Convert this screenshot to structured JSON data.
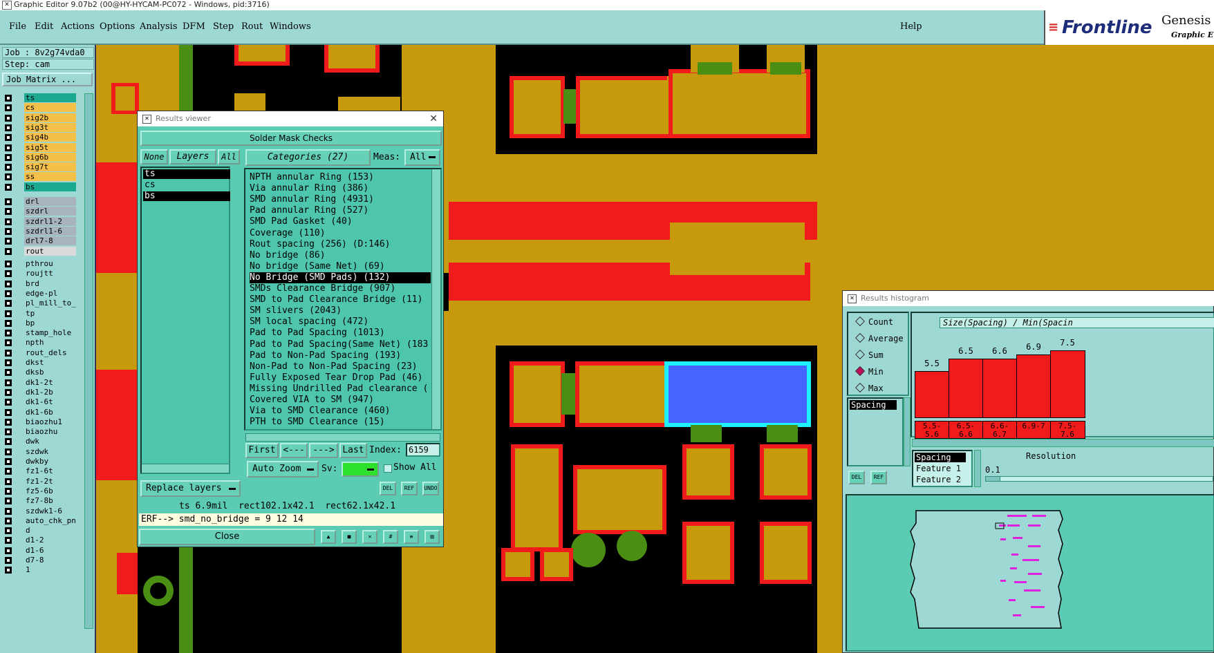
{
  "window": {
    "title": "Graphic Editor 9.07b2 (00@HY-HYCAM-PC072 - Windows, pid:3716)"
  },
  "menu": {
    "items": [
      "File",
      "Edit",
      "Actions",
      "Options",
      "Analysis",
      "DFM",
      "Step",
      "Rout",
      "Windows"
    ],
    "help": "Help"
  },
  "brand": {
    "logo": "Frontline",
    "product": "Genesis",
    "sub": "Graphic E"
  },
  "left": {
    "job": "Job : 8v2g74vda0",
    "step": "Step: cam",
    "job_matrix": "Job Matrix ...",
    "layers": [
      {
        "name": "ts",
        "color": "#1da98f"
      },
      {
        "name": "cs",
        "color": "#f5c04a"
      },
      {
        "name": "sig2b",
        "color": "#f5c04a"
      },
      {
        "name": "sig3t",
        "color": "#f5c04a"
      },
      {
        "name": "sig4b",
        "color": "#f5c04a"
      },
      {
        "name": "sig5t",
        "color": "#f5c04a"
      },
      {
        "name": "sig6b",
        "color": "#f5c04a"
      },
      {
        "name": "sig7t",
        "color": "#f5c04a"
      },
      {
        "name": "ss",
        "color": "#f5c04a"
      },
      {
        "name": "bs",
        "color": "#1da98f"
      },
      {
        "name": "drl",
        "color": "#a8b4bd"
      },
      {
        "name": "szdrl",
        "color": "#a8b4bd"
      },
      {
        "name": "szdrl1-2",
        "color": "#a8b4bd"
      },
      {
        "name": "szdrl1-6",
        "color": "#a8b4bd"
      },
      {
        "name": "drl7-8",
        "color": "#a8b4bd"
      },
      {
        "name": "rout",
        "color": "#d8dadc"
      },
      {
        "name": "pthrou",
        "color": "#9ed8d5"
      },
      {
        "name": "roujtt",
        "color": "#9ed8d5"
      },
      {
        "name": "brd",
        "color": "#9ed8d5"
      },
      {
        "name": "edge-pl",
        "color": "#9ed8d5"
      },
      {
        "name": "pl_mill_to_c",
        "color": "#9ed8d5"
      },
      {
        "name": "tp",
        "color": "#9ed8d5"
      },
      {
        "name": "bp",
        "color": "#9ed8d5"
      },
      {
        "name": "stamp_hole",
        "color": "#9ed8d5"
      },
      {
        "name": "npth",
        "color": "#9ed8d5"
      },
      {
        "name": "rout_dels",
        "color": "#9ed8d5"
      },
      {
        "name": "dkst",
        "color": "#9ed8d5"
      },
      {
        "name": "dksb",
        "color": "#9ed8d5"
      },
      {
        "name": "dk1-2t",
        "color": "#9ed8d5"
      },
      {
        "name": "dk1-2b",
        "color": "#9ed8d5"
      },
      {
        "name": "dk1-6t",
        "color": "#9ed8d5"
      },
      {
        "name": "dk1-6b",
        "color": "#9ed8d5"
      },
      {
        "name": "biaozhu1",
        "color": "#9ed8d5"
      },
      {
        "name": "biaozhu",
        "color": "#9ed8d5"
      },
      {
        "name": "dwk",
        "color": "#9ed8d5"
      },
      {
        "name": "szdwk",
        "color": "#9ed8d5"
      },
      {
        "name": "dwkby",
        "color": "#9ed8d5"
      },
      {
        "name": "fz1-6t",
        "color": "#9ed8d5"
      },
      {
        "name": "fz1-2t",
        "color": "#9ed8d5"
      },
      {
        "name": "fz5-6b",
        "color": "#9ed8d5"
      },
      {
        "name": "fz7-8b",
        "color": "#9ed8d5"
      },
      {
        "name": "szdwk1-6",
        "color": "#9ed8d5"
      },
      {
        "name": "auto_chk_pnl",
        "color": "#9ed8d5"
      },
      {
        "name": "d",
        "color": "#9ed8d5"
      },
      {
        "name": "d1-2",
        "color": "#9ed8d5"
      },
      {
        "name": "d1-6",
        "color": "#9ed8d5"
      },
      {
        "name": "d7-8",
        "color": "#9ed8d5"
      },
      {
        "name": "1",
        "color": "#9ed8d5"
      }
    ]
  },
  "results_viewer": {
    "title": "Results viewer",
    "header": "Solder Mask Checks",
    "none": "None",
    "layers_label": "Layers",
    "all": "All",
    "layer_list": [
      "ts",
      "cs",
      "bs"
    ],
    "categories_label": "Categories (27)",
    "meas_label": "Meas:",
    "meas_value": "All",
    "categories": [
      "NPTH annular Ring (153)",
      "Via annular Ring (386)",
      "SMD annular Ring (4931)",
      "Pad annular Ring (527)",
      "SMD Pad Gasket (40)",
      "Coverage (110)",
      "Rout spacing (256)          (D:146)",
      "No bridge (86)",
      "No bridge (Same Net) (69)",
      "No Bridge (SMD Pads) (132)",
      "SMDs Clearance Bridge (907)",
      "SMD to Pad Clearance Bridge (11)",
      "SM slivers (2043)",
      "SM local spacing (472)",
      "Pad to Pad Spacing (1013)",
      "Pad to Pad Spacing(Same Net) (183",
      "Pad to Non-Pad Spacing (193)",
      "Non-Pad to Non-Pad Spacing (23)",
      "Fully Exposed Tear Drop Pad (46)",
      "Missing Undrilled Pad clearance (",
      "Covered VIA to SM (947)",
      "Via to SMD Clearance (460)",
      "PTH to SMD Clearance (15)"
    ],
    "selected_category": "No Bridge (SMD Pads) (132)",
    "first": "First",
    "prev": "<---",
    "next": "--->",
    "last": "Last",
    "index_label": "Index:",
    "index_value": "6159",
    "auto_zoom": "Auto Zoom",
    "sv_label": "Sv:",
    "show_all": "Show All",
    "replace_layers": "Replace layers",
    "status_line": "ts 6.9mil  rect102.1x42.1  rect62.1x42.1",
    "erf_line": "ERF--> smd_no_bridge = 9 12 14",
    "close": "Close",
    "icons": {
      "del": "DEL",
      "ref": "REF",
      "undo": "UNDO"
    }
  },
  "histogram": {
    "title": "Results histogram",
    "modes": [
      "Count",
      "Average",
      "Sum",
      "Min",
      "Max"
    ],
    "selected_mode": "Min",
    "measure_list": [
      "Spacing"
    ],
    "chart_title": "Size(Spacing) / Min(Spacin",
    "bars": [
      {
        "label": "5.5-5.6",
        "value": "5.5",
        "height": 0.55
      },
      {
        "label": "6.5-6.6",
        "value": "6.5",
        "height": 0.7
      },
      {
        "label": "6.6-6.7",
        "value": "6.6",
        "height": 0.7
      },
      {
        "label": "6.9-7",
        "value": "6.9",
        "height": 0.75
      },
      {
        "label": "7.5-7.6",
        "value": "7.5",
        "height": 0.8
      }
    ],
    "fields": [
      "Spacing",
      "Feature 1",
      "Feature 2"
    ],
    "resolution_label": "Resolution",
    "resolution_value": "0.1",
    "icons": {
      "del": "DEL",
      "ref": "REF"
    }
  },
  "colors": {
    "teal": "#9ed8d5",
    "copper": "#c79a0d",
    "mask_red": "#f21b1b",
    "green": "#4a8f14",
    "blue": "#4466ff",
    "cyan": "#1ef0ff"
  }
}
